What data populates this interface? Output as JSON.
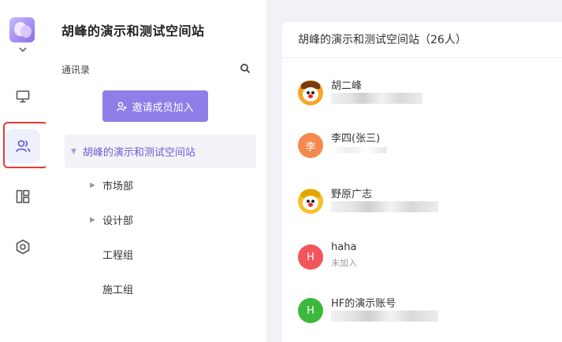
{
  "workspace": {
    "title": "胡峰的演示和测试空间站"
  },
  "rail": {
    "items": [
      {
        "name": "desktop-icon",
        "active": false
      },
      {
        "name": "contacts-icon",
        "active": true
      },
      {
        "name": "dashboard-icon",
        "active": false
      },
      {
        "name": "settings-icon",
        "active": false
      }
    ]
  },
  "sidebar": {
    "section_label": "通讯录",
    "invite_label": "邀请成员加入",
    "tree": {
      "root": "胡峰的演示和测试空间站",
      "children": [
        {
          "label": "市场部",
          "expandable": true
        },
        {
          "label": "设计部",
          "expandable": true
        },
        {
          "label": "工程组",
          "expandable": false
        },
        {
          "label": "施工组",
          "expandable": false
        }
      ]
    }
  },
  "members_panel": {
    "title": "胡峰的演示和测试空间站（26人）",
    "members": [
      {
        "name": "胡二峰",
        "avatar": "cartoon",
        "sub": ""
      },
      {
        "name": "李四(张三)",
        "avatar": "李",
        "avatar_color": "#f5894e",
        "sub": ""
      },
      {
        "name": "野原广志",
        "avatar": "cartoon",
        "sub": ""
      },
      {
        "name": "haha",
        "avatar": "H",
        "avatar_color": "#f2555a",
        "sub": "未加入"
      },
      {
        "name": "HF的演示账号",
        "avatar": "H",
        "avatar_color": "#3cb83c",
        "sub": ""
      }
    ]
  },
  "colors": {
    "accent": "#8d7ee8",
    "highlight_border": "#e53935",
    "panel_bg": "#f2f2f6"
  }
}
